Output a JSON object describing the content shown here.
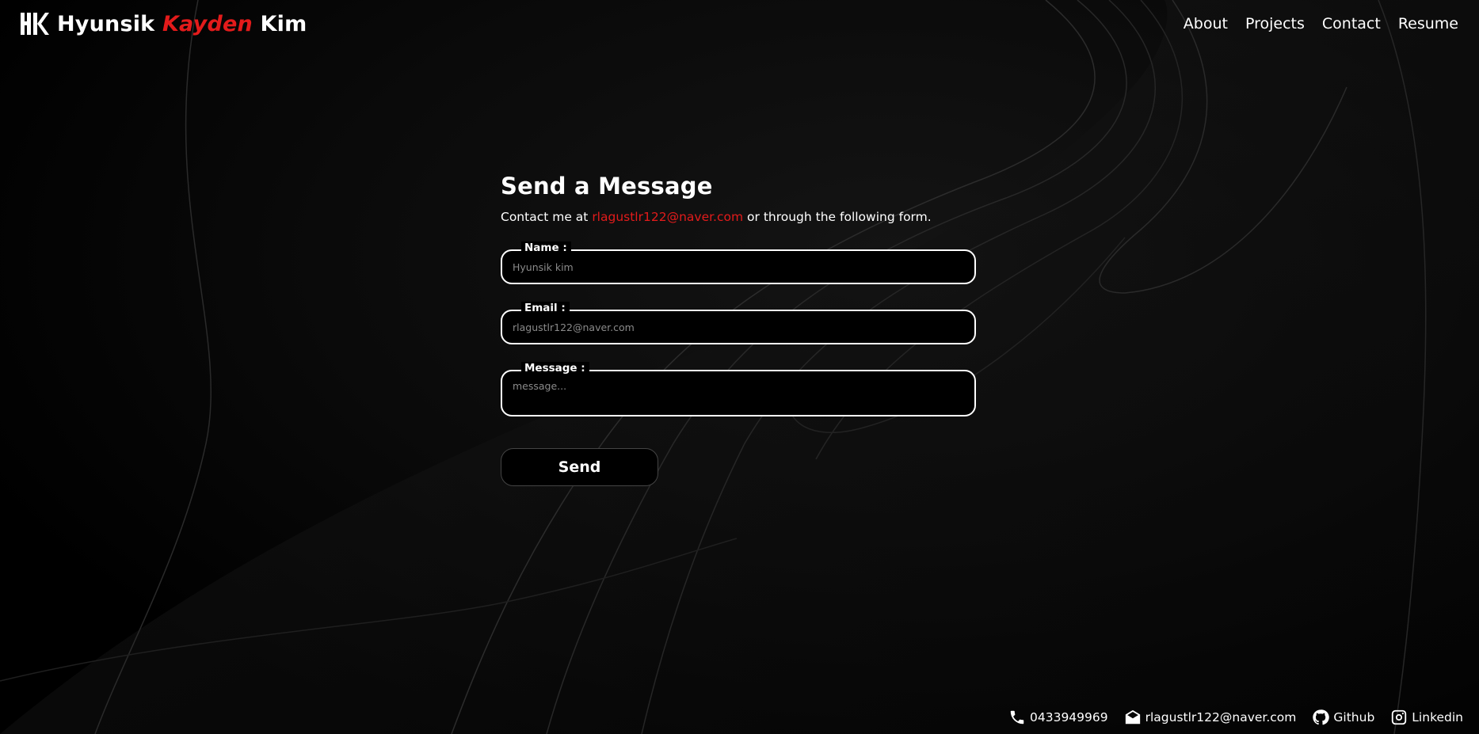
{
  "header": {
    "logo": {
      "first": "Hyunsik",
      "middle": "Kayden",
      "last": "Kim",
      "mark_icon": "hk-monogram-icon"
    },
    "nav": [
      {
        "label": "About"
      },
      {
        "label": "Projects"
      },
      {
        "label": "Contact"
      },
      {
        "label": "Resume"
      }
    ]
  },
  "contact": {
    "title": "Send a Message",
    "intro_before": "Contact me at",
    "intro_email": "rlagustlr122@naver.com",
    "intro_after": "or through the following form.",
    "fields": {
      "name": {
        "label": "Name :",
        "placeholder": "Hyunsik kim",
        "value": ""
      },
      "email": {
        "label": "Email :",
        "placeholder": "rlagustlr122@naver.com",
        "value": ""
      },
      "message": {
        "label": "Message :",
        "placeholder": "message...",
        "value": ""
      }
    },
    "send_label": "Send"
  },
  "footer": {
    "phone": {
      "text": "0433949969",
      "icon": "phone-icon"
    },
    "email": {
      "text": "rlagustlr122@naver.com",
      "icon": "envelope-icon"
    },
    "github": {
      "text": "Github",
      "icon": "github-icon"
    },
    "linkedin": {
      "text": "Linkedin",
      "icon": "instagram-icon"
    }
  },
  "colors": {
    "background": "#000000",
    "accent": "#e31b1b",
    "text": "#ffffff",
    "placeholder": "#8a8a8a"
  }
}
